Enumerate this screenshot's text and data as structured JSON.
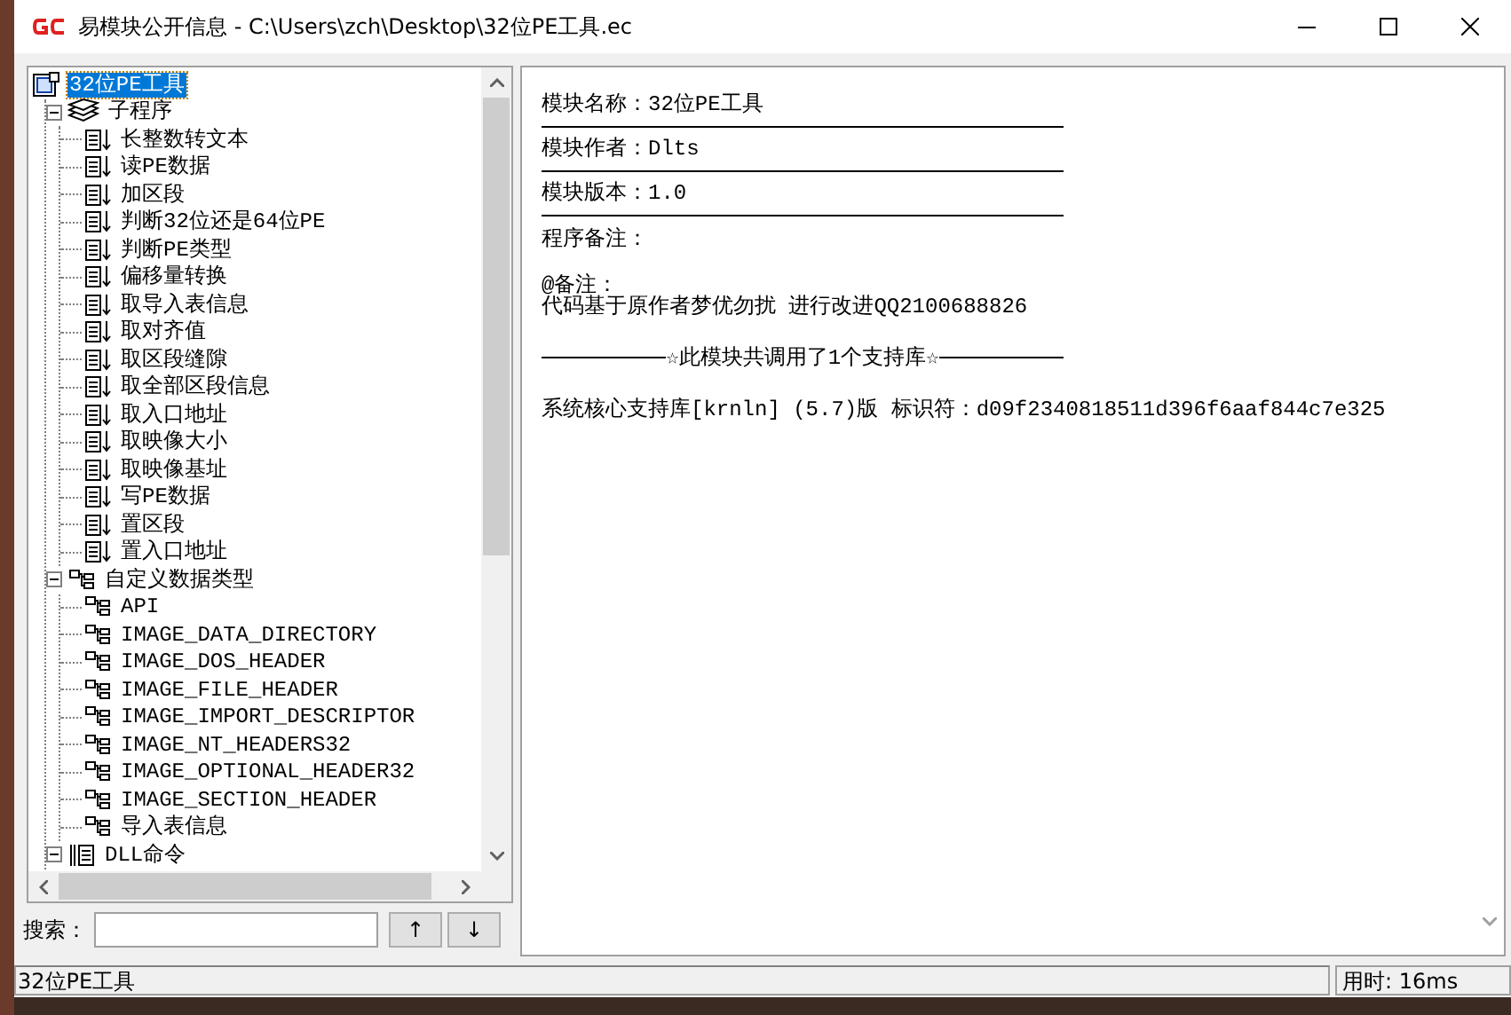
{
  "window": {
    "title": "易模块公开信息 - C:\\Users\\zch\\Desktop\\32位PE工具.ec"
  },
  "tree": {
    "label": "32位PE工具",
    "kind": "module",
    "selected": true,
    "children": [
      {
        "label": "子程序",
        "kind": "sub-group",
        "selected": false,
        "expanded": true,
        "children": [
          {
            "label": "长整数转文本",
            "kind": "sub",
            "selected": false
          },
          {
            "label": "读PE数据",
            "kind": "sub",
            "selected": false
          },
          {
            "label": "加区段",
            "kind": "sub",
            "selected": false
          },
          {
            "label": "判断32位还是64位PE",
            "kind": "sub",
            "selected": false
          },
          {
            "label": "判断PE类型",
            "kind": "sub",
            "selected": false
          },
          {
            "label": "偏移量转换",
            "kind": "sub",
            "selected": false
          },
          {
            "label": "取导入表信息",
            "kind": "sub",
            "selected": false
          },
          {
            "label": "取对齐值",
            "kind": "sub",
            "selected": false
          },
          {
            "label": "取区段缝隙",
            "kind": "sub",
            "selected": false
          },
          {
            "label": "取全部区段信息",
            "kind": "sub",
            "selected": false
          },
          {
            "label": "取入口地址",
            "kind": "sub",
            "selected": false
          },
          {
            "label": "取映像大小",
            "kind": "sub",
            "selected": false
          },
          {
            "label": "取映像基址",
            "kind": "sub",
            "selected": false
          },
          {
            "label": "写PE数据",
            "kind": "sub",
            "selected": false
          },
          {
            "label": "置区段",
            "kind": "sub",
            "selected": false
          },
          {
            "label": "置入口地址",
            "kind": "sub",
            "selected": false
          }
        ]
      },
      {
        "label": "自定义数据类型",
        "kind": "type-group",
        "selected": false,
        "expanded": true,
        "children": [
          {
            "label": "API",
            "kind": "type",
            "selected": false
          },
          {
            "label": "IMAGE_DATA_DIRECTORY",
            "kind": "type",
            "selected": false
          },
          {
            "label": "IMAGE_DOS_HEADER",
            "kind": "type",
            "selected": false
          },
          {
            "label": "IMAGE_FILE_HEADER",
            "kind": "type",
            "selected": false
          },
          {
            "label": "IMAGE_IMPORT_DESCRIPTOR",
            "kind": "type",
            "selected": false
          },
          {
            "label": "IMAGE_NT_HEADERS32",
            "kind": "type",
            "selected": false
          },
          {
            "label": "IMAGE_OPTIONAL_HEADER32",
            "kind": "type",
            "selected": false
          },
          {
            "label": "IMAGE_SECTION_HEADER",
            "kind": "type",
            "selected": false
          },
          {
            "label": "导入表信息",
            "kind": "type",
            "selected": false
          }
        ]
      },
      {
        "label": "DLL命令",
        "kind": "dll-group",
        "selected": false,
        "expanded": true
      }
    ]
  },
  "search": {
    "label": "搜索：",
    "buttons": [
      "↑",
      "↓"
    ]
  },
  "info": {
    "fields": [
      "模块名称：32位PE工具",
      "模块作者：Dlts",
      "模块版本：1.0"
    ],
    "remark_label": "程序备注：",
    "remark_lines": [
      "@备注：",
      "代码基于原作者梦优勿扰 进行改进QQ2100688826"
    ],
    "library_header": "☆此模块共调用了1个支持库☆",
    "libraries": [
      "系统核心支持库[krnln] (5.7)版 标识符：d09f2340818511d396f6aaf844c7e325"
    ]
  },
  "status_bar": {
    "left": "32位PE工具",
    "right": "用时: 16ms"
  }
}
